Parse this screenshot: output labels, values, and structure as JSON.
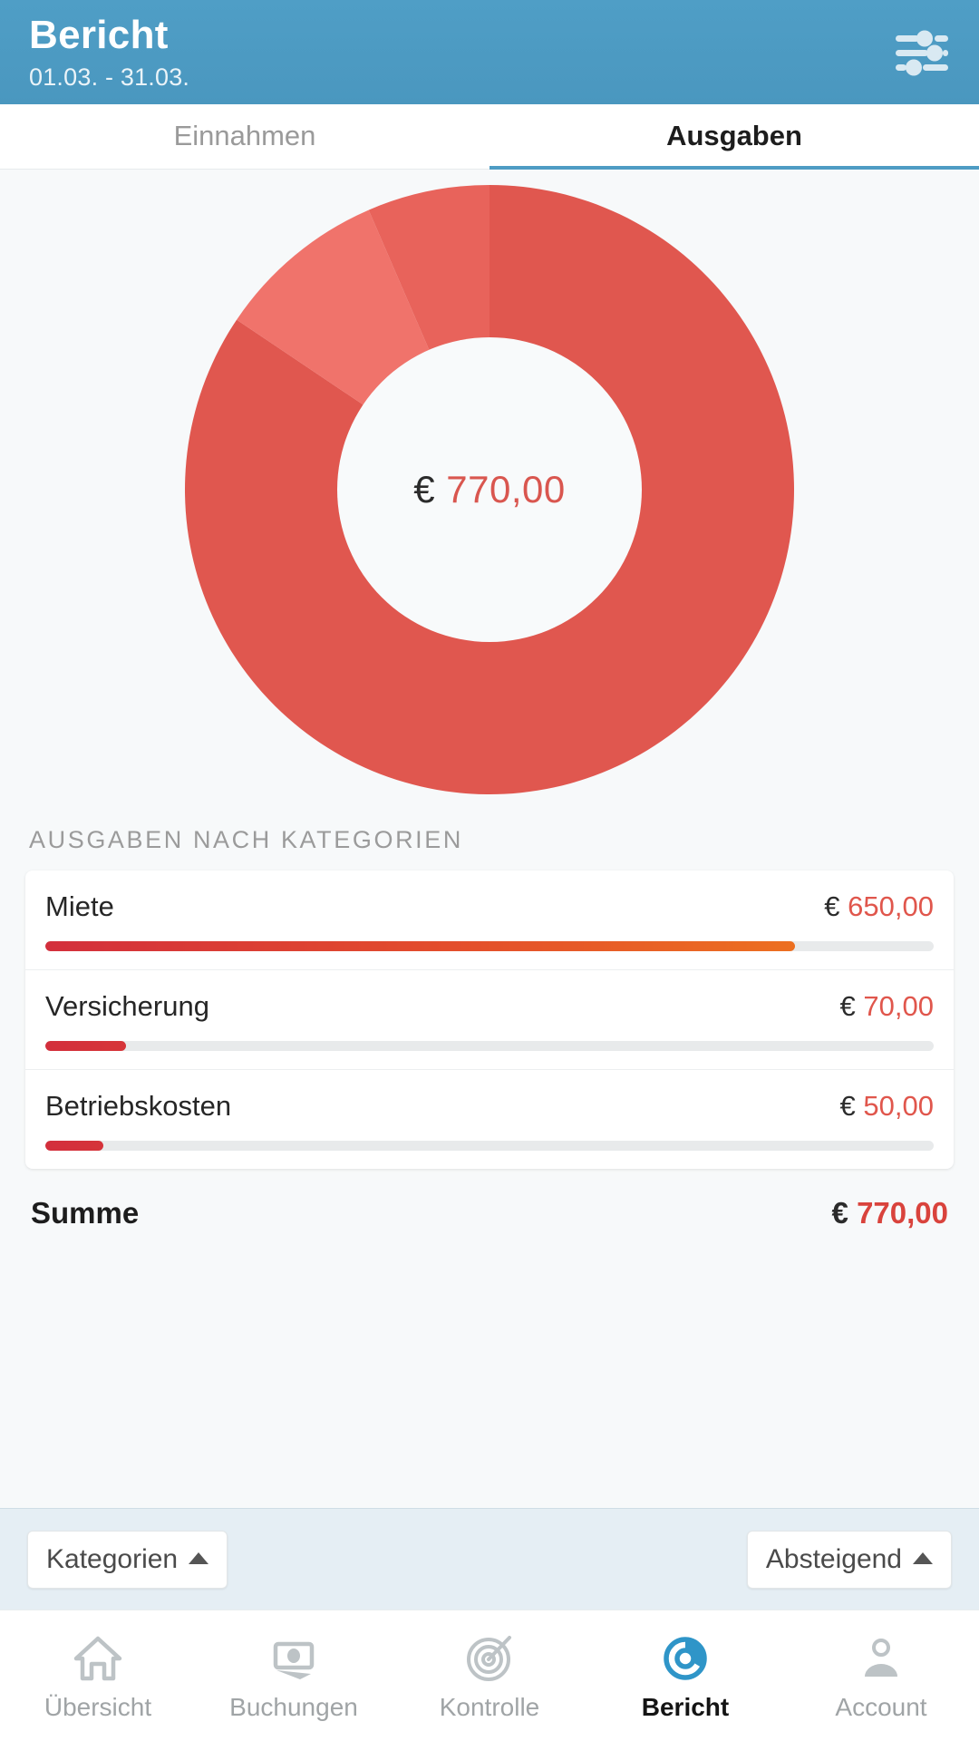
{
  "header": {
    "title": "Bericht",
    "date_range": "01.03. - 31.03.",
    "action_icon": "tune-sliders-icon",
    "bg_color": "#4e9cc4"
  },
  "tabs": [
    {
      "label": "Einnahmen",
      "active": false
    },
    {
      "label": "Ausgaben",
      "active": true
    }
  ],
  "donut": {
    "center_currency": "€",
    "center_amount": "770,00"
  },
  "section": {
    "label": "Ausgaben nach Kategorien"
  },
  "categories": [
    {
      "name": "Miete",
      "currency": "€",
      "amount": "650,00",
      "value": 650,
      "percent": 84.4
    },
    {
      "name": "Versicherung",
      "currency": "€",
      "amount": "70,00",
      "value": 70,
      "percent": 9.1
    },
    {
      "name": "Betriebskosten",
      "currency": "€",
      "amount": "50,00",
      "value": 50,
      "percent": 6.5
    }
  ],
  "total": {
    "label": "Summe",
    "currency": "€",
    "amount": "770,00"
  },
  "sort": {
    "group_by_label": "Kategorien",
    "group_by_caret": "caret-up-icon",
    "order_label": "Absteigend",
    "order_caret": "caret-up-icon"
  },
  "bottom_nav": [
    {
      "label": "Übersicht",
      "icon": "home-icon",
      "active": false
    },
    {
      "label": "Buchungen",
      "icon": "banknote-icon",
      "active": false
    },
    {
      "label": "Kontrolle",
      "icon": "target-icon",
      "active": false
    },
    {
      "label": "Bericht",
      "icon": "donut-chart-icon",
      "active": true
    },
    {
      "label": "Account",
      "icon": "person-icon",
      "active": false
    }
  ],
  "colors": {
    "header_blue": "#4e9cc4",
    "accent_blue": "#2f95c8",
    "expense_red": "#e0564c",
    "total_red": "#d9433c",
    "bar_start": "#d32f3c",
    "bar_end": "#f07d1c",
    "donut_slice_1": "#e0574f",
    "donut_slice_2": "#f0736b",
    "donut_slice_3": "#e8635b",
    "page_bg": "#f7f9fa",
    "sortbar_bg": "#e5eef4"
  },
  "chart_data": {
    "type": "pie",
    "title": "Ausgaben",
    "subtitle": "Ausgaben nach Kategorien",
    "labels": [
      "Miete",
      "Versicherung",
      "Betriebskosten"
    ],
    "values": [
      650,
      70,
      50
    ],
    "percents": [
      84.4,
      9.1,
      6.5
    ],
    "colors": [
      "#e0574f",
      "#f0736b",
      "#e8635b"
    ],
    "currency": "€",
    "total": 770,
    "total_formatted": "770,00",
    "center_label": "€ 770,00",
    "donut": true,
    "inner_radius_ratio": 0.5,
    "start_angle_deg": -90,
    "direction": "clockwise",
    "legend": "none",
    "grid": false
  }
}
